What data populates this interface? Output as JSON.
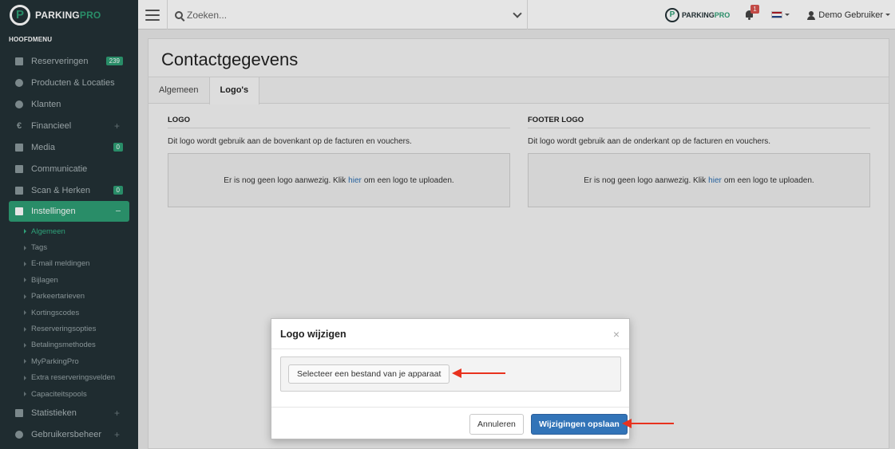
{
  "app": {
    "brand_primary": "PARKING",
    "brand_secondary": "PRO",
    "brand_color": "#2e9d74",
    "sidebar_color": "#233236"
  },
  "topbar": {
    "search_placeholder": "Zoeken...",
    "notification_count": "1",
    "user_name": "Demo Gebruiker",
    "language_flag": "nl-flag-icon"
  },
  "sidebar": {
    "heading": "HOOFDMENU",
    "items": [
      {
        "label": "Reserveringen",
        "icon": "calendar-icon",
        "badge": "239"
      },
      {
        "label": "Producten & Locaties",
        "icon": "map-marker-icon"
      },
      {
        "label": "Klanten",
        "icon": "user-icon"
      },
      {
        "label": "Financieel",
        "icon": "euro-icon",
        "expand": "+"
      },
      {
        "label": "Media",
        "icon": "image-icon",
        "badge": "0"
      },
      {
        "label": "Communicatie",
        "icon": "envelope-icon"
      },
      {
        "label": "Scan & Herken",
        "icon": "camera-icon",
        "badge": "0"
      },
      {
        "label": "Instellingen",
        "icon": "wrench-icon",
        "active": true
      }
    ],
    "sub_items": [
      "Algemeen",
      "Tags",
      "E-mail meldingen",
      "Bijlagen",
      "Parkeertarieven",
      "Kortingscodes",
      "Reserveringsopties",
      "Betalingsmethodes",
      "MyParkingPro",
      "Extra reserveringsvelden",
      "Capaciteitspools"
    ],
    "bottom_items": [
      {
        "label": "Statistieken",
        "icon": "bar-chart-icon",
        "expand": "+"
      },
      {
        "label": "Gebruikersbeheer",
        "icon": "users-icon",
        "expand": "+"
      }
    ]
  },
  "main": {
    "page_title": "Contactgegevens",
    "tabs": [
      {
        "label": "Algemeen"
      },
      {
        "label": "Logo's",
        "active": true
      }
    ],
    "logo": {
      "heading": "LOGO",
      "description": "Dit logo wordt gebruik aan de bovenkant op de facturen en vouchers.",
      "empty_before": "Er is nog geen logo aanwezig. Klik",
      "empty_link": "hier",
      "empty_after": "om een logo te uploaden."
    },
    "footer_logo": {
      "heading": "FOOTER LOGO",
      "description": "Dit logo wordt gebruik aan de onderkant op de facturen en vouchers.",
      "empty_before": "Er is nog geen logo aanwezig. Klik",
      "empty_link": "hier",
      "empty_after": "om een logo te uploaden."
    }
  },
  "modal": {
    "title": "Logo wijzigen",
    "close": "×",
    "file_button": "Selecteer een bestand van je apparaat",
    "cancel_button": "Annuleren",
    "save_button": "Wijzigingen opslaan",
    "primary_color": "#3274b8",
    "annotation_color": "#e8321e"
  }
}
